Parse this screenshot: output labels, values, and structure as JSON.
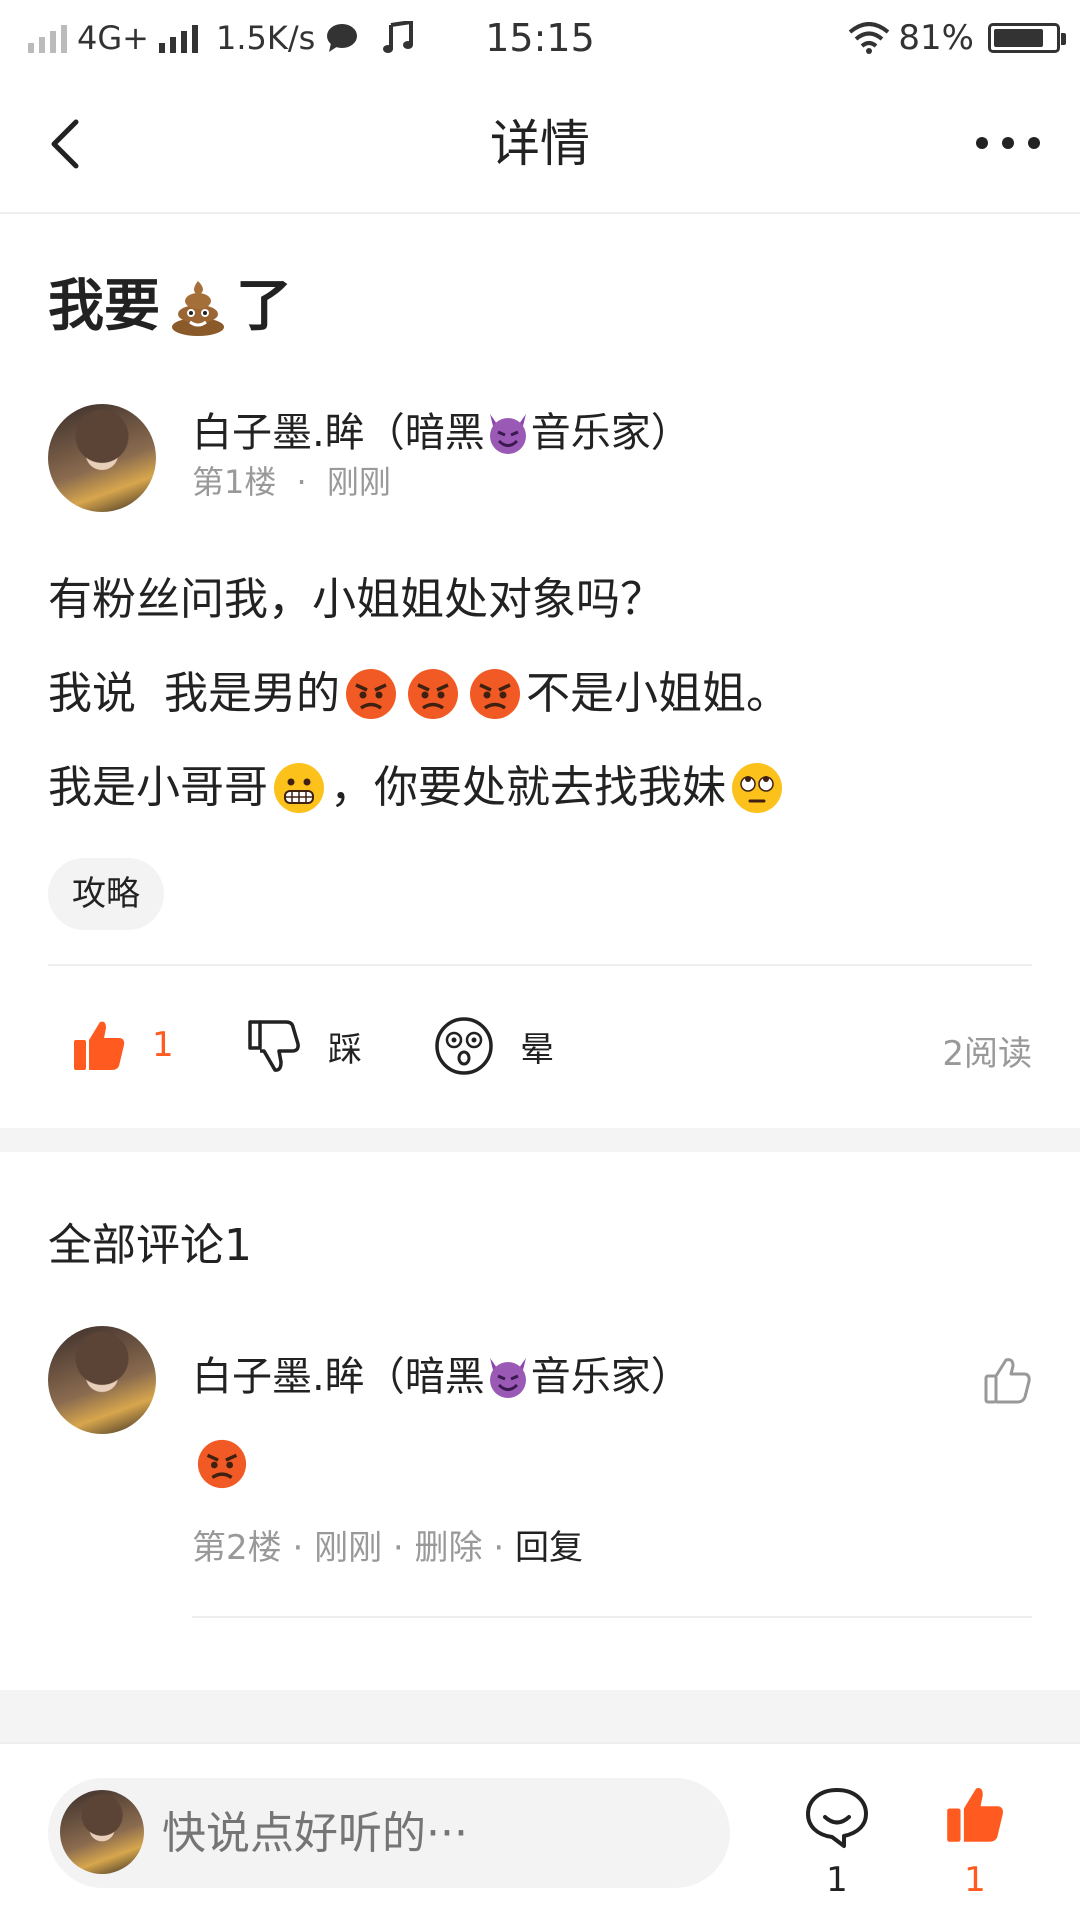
{
  "status_bar": {
    "network": "4G+",
    "speed": "1.5K/s",
    "time": "15:15",
    "battery": "81%",
    "battery_level": 0.81
  },
  "nav": {
    "title": "详情",
    "back_icon": "chevron-left-icon",
    "more_icon": "more-dots-icon"
  },
  "post": {
    "title_part1": "我要",
    "title_emoji": "poop-emoji",
    "title_part2": "了",
    "author": {
      "name_part1": "白子墨.眸（暗黑",
      "name_emoji": "devil-emoji",
      "name_part2": "音乐家）",
      "floor": "第1楼",
      "separator": "·",
      "time": "刚刚"
    },
    "lines": {
      "line1": "有粉丝问我，小姐姐处对象吗？",
      "line2_part1": "我说  我是男的",
      "line2_emoji": "angry-face-emoji",
      "line2_part2": "不是小姐姐。",
      "line3_part1": "我是小哥哥",
      "line3_emoji1": "grimacing-face-emoji",
      "line3_part2": "，你要处就去找我妹",
      "line3_emoji2": "rolling-eyes-emoji"
    },
    "tag": "攻略",
    "actions": {
      "like_count": "1",
      "dislike_label": "踩",
      "dizzy_label": "晕"
    },
    "reads": "2阅读"
  },
  "comments": {
    "header": "全部评论1",
    "items": [
      {
        "name_part1": "白子墨.眸（暗黑",
        "name_emoji": "devil-emoji",
        "name_part2": "音乐家）",
        "content_emoji": "angry-face-emoji",
        "floor": "第2楼",
        "sep": "·",
        "time": "刚刚",
        "delete": "删除",
        "reply": "回复"
      }
    ]
  },
  "bottom_bar": {
    "placeholder": "快说点好听的···",
    "comment_count": "1",
    "like_count": "1"
  },
  "colors": {
    "accent": "#ff5a1f",
    "text": "#222222",
    "muted": "#999999",
    "divider": "#eeeeee",
    "band": "#f4f4f4"
  }
}
